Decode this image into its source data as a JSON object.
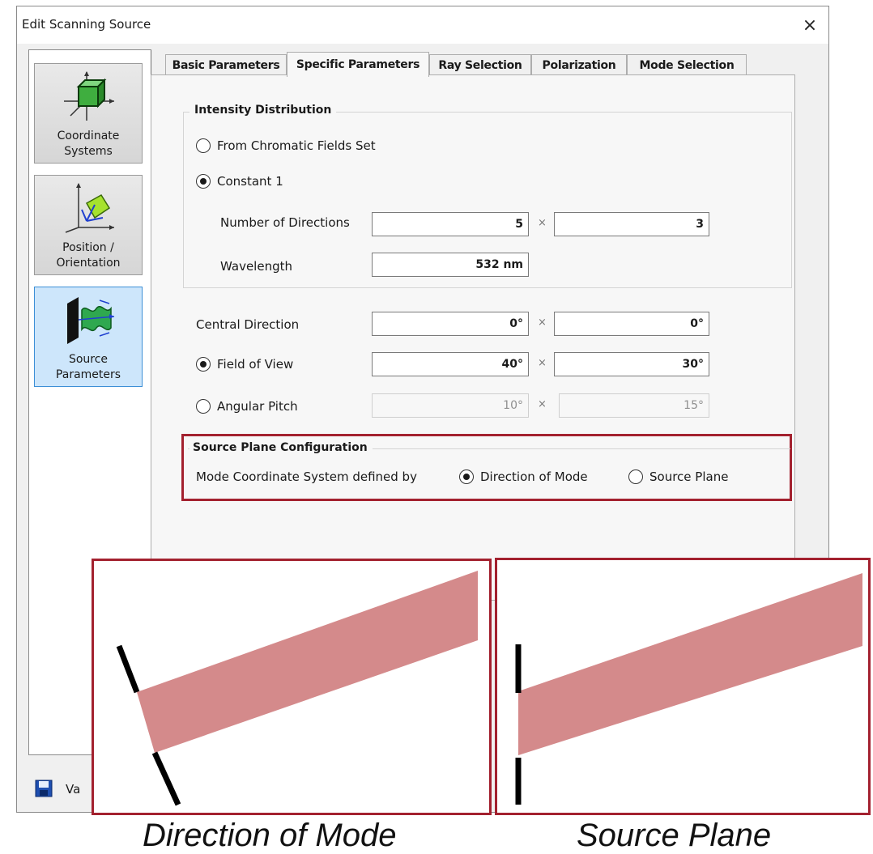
{
  "window": {
    "title": "Edit Scanning Source",
    "close_glyph": "×"
  },
  "nav": {
    "items": [
      {
        "label": "Coordinate\nSystems",
        "icon": "coordinate-systems-icon",
        "selected": false
      },
      {
        "label": "Position /\nOrientation",
        "icon": "position-orientation-icon",
        "selected": false
      },
      {
        "label": "Source\nParameters",
        "icon": "source-parameters-icon",
        "selected": true
      }
    ]
  },
  "tabs": [
    {
      "label": "Basic Parameters",
      "active": false
    },
    {
      "label": "Specific Parameters",
      "active": true
    },
    {
      "label": "Ray Selection",
      "active": false
    },
    {
      "label": "Polarization",
      "active": false
    },
    {
      "label": "Mode Selection",
      "active": false
    }
  ],
  "intensity": {
    "title": "Intensity Distribution",
    "option_chromatic": "From Chromatic Fields Set",
    "option_constant": "Constant 1",
    "selected": "Constant 1",
    "num_directions_label": "Number of Directions",
    "num_directions_x": "5",
    "num_directions_y": "3",
    "wavelength_label": "Wavelength",
    "wavelength_value": "532 nm"
  },
  "direction": {
    "central_label": "Central Direction",
    "central_x": "0°",
    "central_y": "0°",
    "fov_label": "Field of View",
    "fov_x": "40°",
    "fov_y": "30°",
    "pitch_label": "Angular Pitch",
    "pitch_x": "10°",
    "pitch_y": "15°",
    "selected": "Field of View",
    "times_glyph": "×"
  },
  "source_plane": {
    "title": "Source Plane Configuration",
    "mode_label": "Mode Coordinate System defined by",
    "option_direction": "Direction of Mode",
    "option_plane": "Source Plane",
    "selected": "Direction of Mode",
    "highlight_color": "#a3212f"
  },
  "bottom": {
    "text": "Va"
  },
  "overlay": {
    "beam_color": "#d48a8b",
    "border_color": "#a3212f",
    "caption_left": "Direction of Mode",
    "caption_right": "Source Plane"
  }
}
